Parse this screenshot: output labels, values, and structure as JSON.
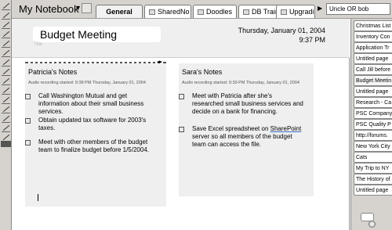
{
  "notebook": {
    "title": "My Notebook",
    "arrow": "▼"
  },
  "tabs": [
    "General",
    "SharedNo",
    "Doodles",
    "DB Training",
    "Upgradin"
  ],
  "tabs_scroll_arrow": "▶",
  "search": {
    "value": "Uncle OR bob"
  },
  "page": {
    "title": "Budget Meeting",
    "title_hint": "Title",
    "date": "Thursday, January 01, 2004",
    "time": "9:37 PM"
  },
  "notes": {
    "patricia": {
      "heading": "Patricia's Notes",
      "meta": "Audio recording started: 9:38 PM Thursday, January 01, 2004",
      "tasks": [
        "Call Washington Mutual and get information about their small business services.",
        "Obtain updated tax software for 2003's taxes.",
        "Meet with other members of the budget team to finalize budget before 1/5/2004."
      ]
    },
    "sara": {
      "heading": "Sara's Notes",
      "meta": "Audio recording started: 9:39 PM Thursday, January 01, 2004",
      "tasks": [
        "Meet with Patricia after she's researched small business services and decide on a bank for financing.",
        "Save Excel spreadsheet on SharePoint server so all members of the budget team can access the file."
      ]
    }
  },
  "page_tabs": [
    "Christmas List",
    "Inventory Con",
    "Application Tr",
    "Untitled page",
    "Call Jill before",
    "Budget Meetin",
    "Untitled page",
    "Research - Ca",
    "PSC Company",
    "PSC Quality P",
    "http://forums.",
    "New York City",
    "Cats",
    "My Trip to NY",
    "The History of",
    "Untitled page"
  ]
}
